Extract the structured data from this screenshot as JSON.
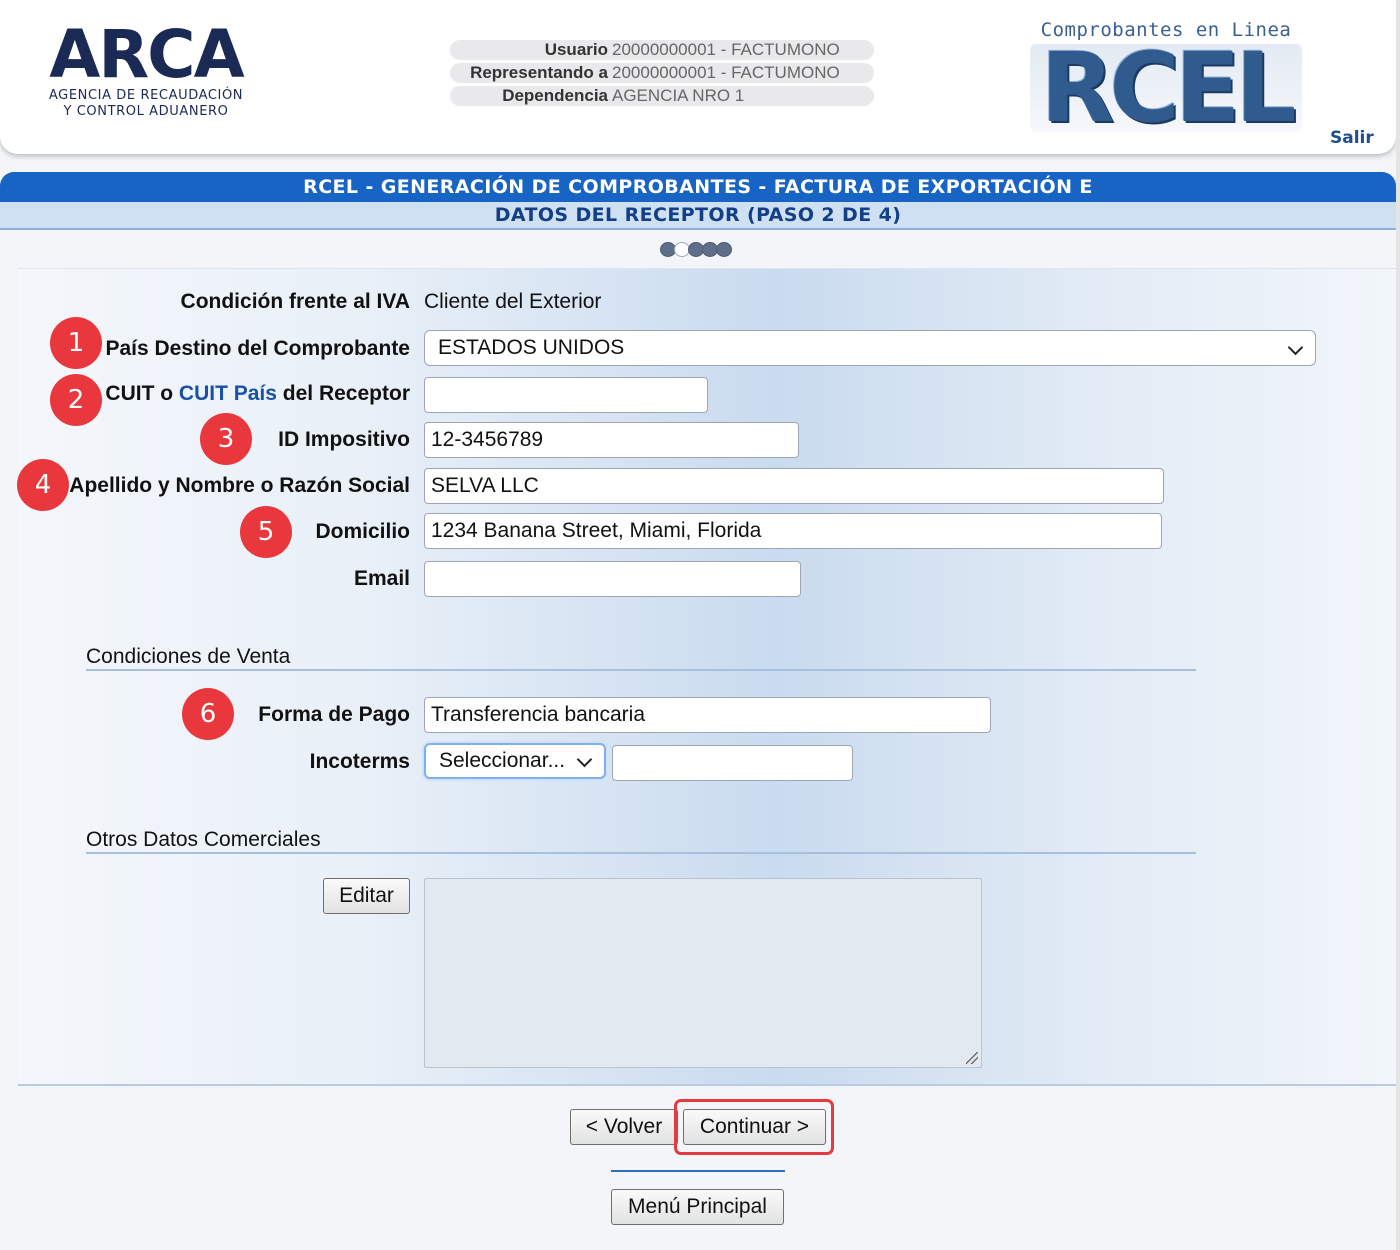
{
  "header": {
    "logo_word": "ARCA",
    "logo_sub_line1": "AGENCIA DE RECAUDACIÓN",
    "logo_sub_line2": "Y CONTROL ADUANERO",
    "user_info": [
      {
        "label": "Usuario",
        "value": "20000000001 - FACTUMONO"
      },
      {
        "label": "Representando a",
        "value": "20000000001 - FACTUMONO"
      },
      {
        "label": "Dependencia",
        "value": "AGENCIA NRO 1"
      }
    ],
    "rcel_tagline": "Comprobantes en Linea",
    "rcel_word": "RCEL",
    "logout_label": "Salir"
  },
  "title": {
    "line1": "RCEL - GENERACIÓN DE COMPROBANTES - FACTURA DE EXPORTACIÓN E",
    "line2": "DATOS DEL RECEPTOR (PASO 2 DE 4)"
  },
  "steps": {
    "total": 5,
    "current": 2
  },
  "form": {
    "iva": {
      "label": "Condición frente al IVA",
      "value": "Cliente del Exterior"
    },
    "pais": {
      "label": "País Destino del Comprobante",
      "value": "ESTADOS UNIDOS",
      "badge": "1"
    },
    "cuit": {
      "label_pre": "CUIT o ",
      "label_link": "CUIT País",
      "label_post": " del Receptor",
      "value": "",
      "badge": "2"
    },
    "id_impositivo": {
      "label": "ID Impositivo",
      "value": "12-3456789",
      "badge": "3"
    },
    "nombre": {
      "label": "Apellido y Nombre o Razón Social",
      "value": "SELVA LLC",
      "badge": "4"
    },
    "domicilio": {
      "label": "Domicilio",
      "value": "1234 Banana Street, Miami, Florida",
      "badge": "5"
    },
    "email": {
      "label": "Email",
      "value": ""
    }
  },
  "venta": {
    "section_title": "Condiciones de Venta",
    "forma_pago": {
      "label": "Forma de Pago",
      "value": "Transferencia bancaria",
      "badge": "6"
    },
    "incoterms": {
      "label": "Incoterms",
      "selected": "Seleccionar...",
      "detail": ""
    }
  },
  "otros": {
    "section_title": "Otros Datos Comerciales",
    "edit_label": "Editar",
    "text": ""
  },
  "nav": {
    "back_label": "< Volver",
    "continue_label": "Continuar >",
    "main_menu_label": "Menú Principal"
  },
  "colors": {
    "title_bar": "#1764c4",
    "badge": "#e8383d",
    "highlight": "#e33b3f"
  }
}
